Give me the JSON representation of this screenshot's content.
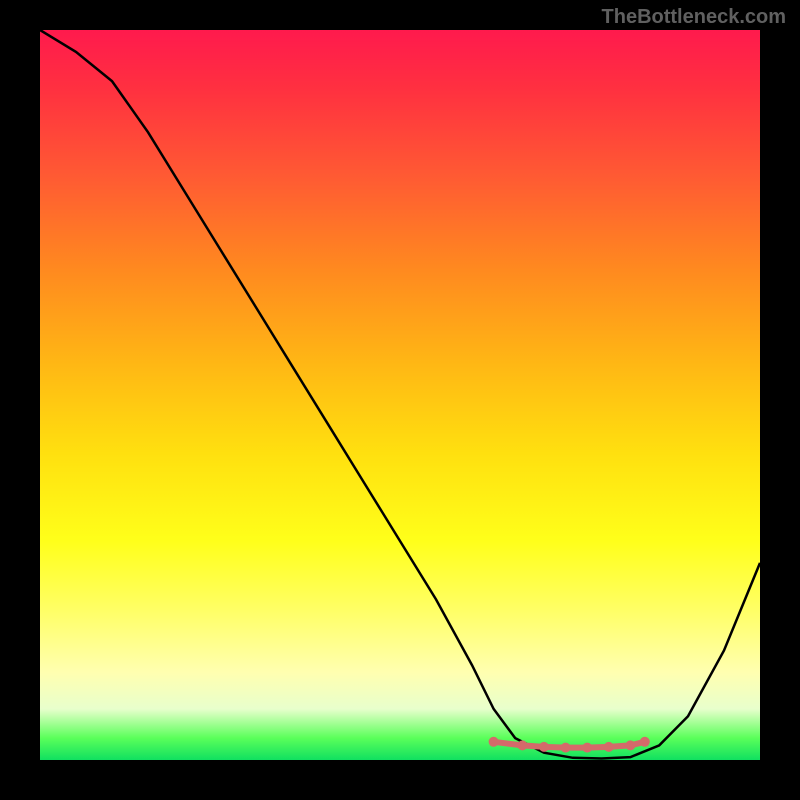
{
  "watermark": "TheBottleneck.com",
  "chart_data": {
    "type": "line",
    "title": "",
    "xlabel": "",
    "ylabel": "",
    "xlim": [
      0,
      100
    ],
    "ylim": [
      0,
      100
    ],
    "series": [
      {
        "name": "bottleneck-curve",
        "x": [
          0,
          5,
          10,
          15,
          20,
          25,
          30,
          35,
          40,
          45,
          50,
          55,
          60,
          63,
          66,
          70,
          74,
          78,
          82,
          86,
          90,
          95,
          100
        ],
        "y": [
          100,
          97,
          93,
          86,
          78,
          70,
          62,
          54,
          46,
          38,
          30,
          22,
          13,
          7,
          3,
          1,
          0.3,
          0.2,
          0.4,
          2,
          6,
          15,
          27
        ]
      },
      {
        "name": "highlight-dots",
        "x": [
          63,
          67,
          70,
          73,
          76,
          79,
          82,
          84
        ],
        "y": [
          2.5,
          2.0,
          1.8,
          1.7,
          1.7,
          1.8,
          2.0,
          2.5
        ]
      }
    ],
    "colors": {
      "curve": "#000000",
      "dots": "#d46a6a"
    }
  }
}
